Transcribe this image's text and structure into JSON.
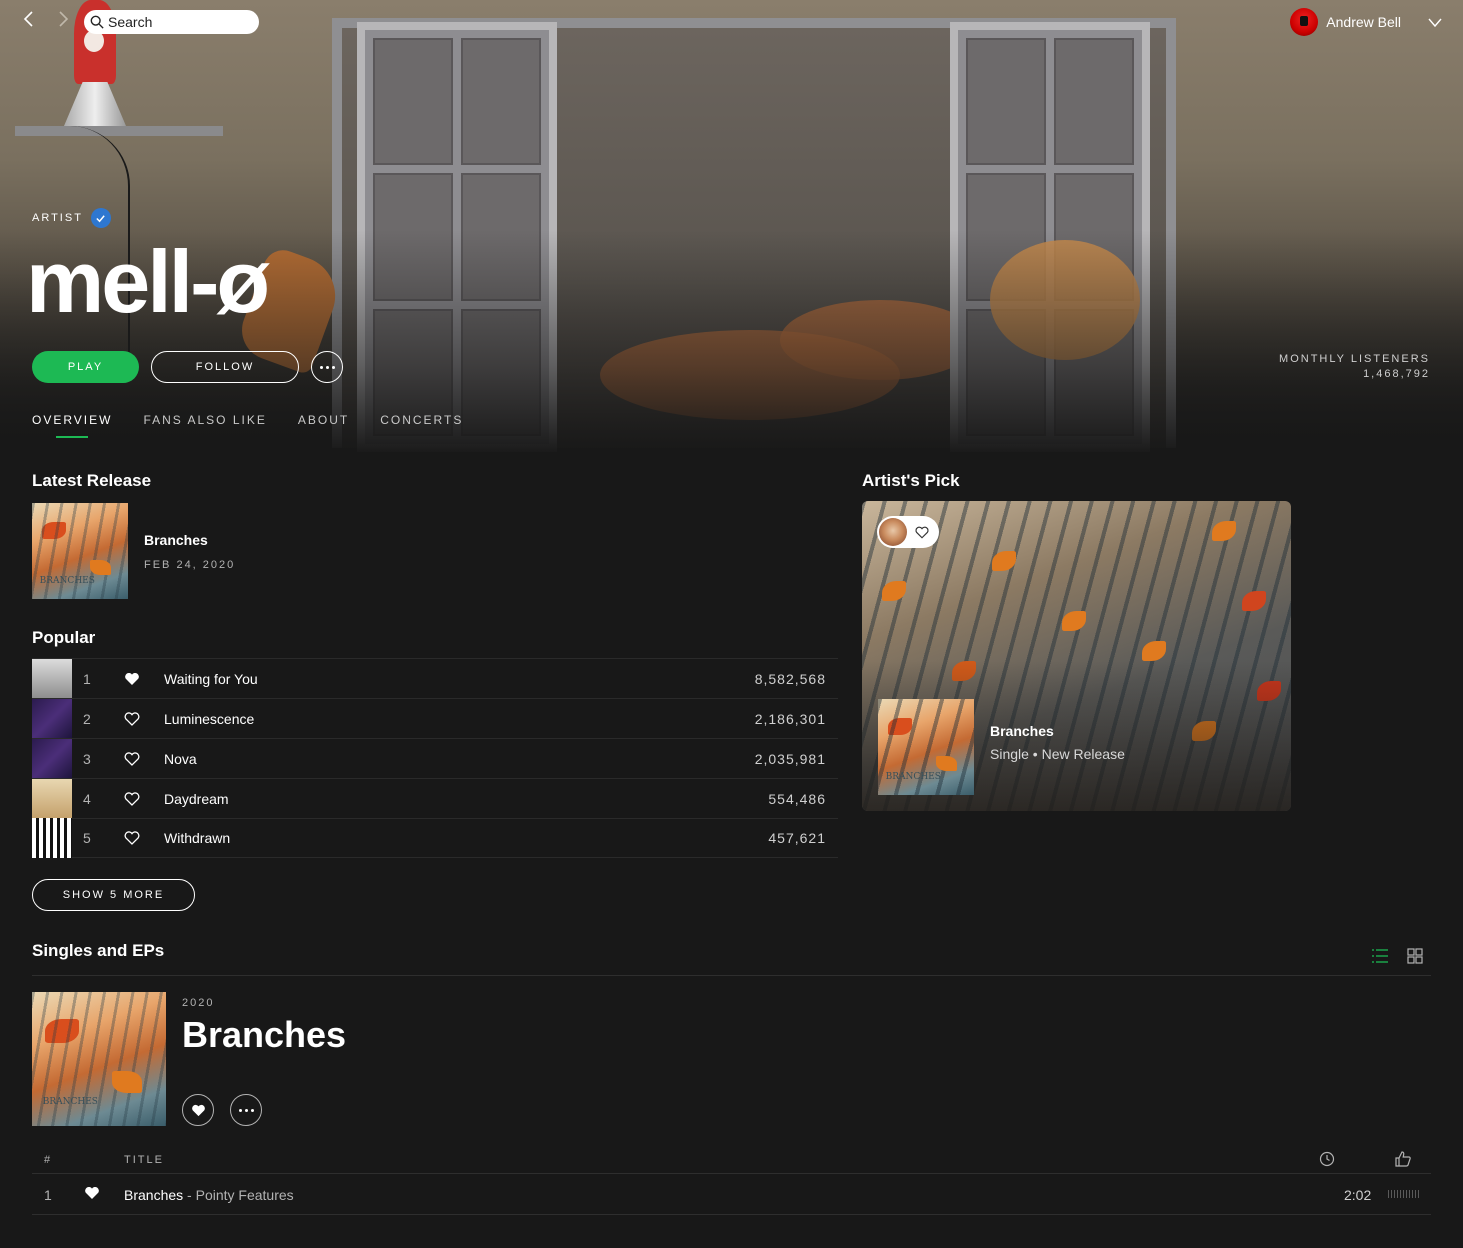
{
  "topbar": {
    "back_icon": "chevron-left-icon",
    "forward_icon": "chevron-right-icon",
    "search_placeholder": "Search",
    "user_name": "Andrew Bell"
  },
  "hero": {
    "label": "ARTIST",
    "artist_name": "mell-ø",
    "play_label": "PLAY",
    "follow_label": "FOLLOW",
    "monthly_label": "MONTHLY LISTENERS",
    "monthly_value": "1,468,792"
  },
  "tabs": [
    {
      "label": "OVERVIEW",
      "active": true
    },
    {
      "label": "FANS ALSO LIKE",
      "active": false
    },
    {
      "label": "ABOUT",
      "active": false
    },
    {
      "label": "CONCERTS",
      "active": false
    }
  ],
  "latest_release": {
    "heading": "Latest Release",
    "title": "Branches",
    "date": "FEB 24, 2020",
    "cover_text": "BRANCHES"
  },
  "popular": {
    "heading": "Popular",
    "tracks": [
      {
        "num": "1",
        "title": "Waiting for You",
        "plays": "8,582,568",
        "liked": true
      },
      {
        "num": "2",
        "title": "Luminescence",
        "plays": "2,186,301",
        "liked": false
      },
      {
        "num": "3",
        "title": "Nova",
        "plays": "2,035,981",
        "liked": false
      },
      {
        "num": "4",
        "title": "Daydream",
        "plays": "554,486",
        "liked": false
      },
      {
        "num": "5",
        "title": "Withdrawn",
        "plays": "457,621",
        "liked": false
      }
    ],
    "show_more_label": "SHOW 5 MORE"
  },
  "artists_pick": {
    "heading": "Artist's Pick",
    "title": "Branches",
    "subtitle": "Single • New Release",
    "cover_text": "BRANCHES"
  },
  "singles": {
    "heading": "Singles and EPs",
    "album_year": "2020",
    "album_title": "Branches",
    "cover_text": "BRANCHES",
    "header_num": "#",
    "header_title": "TITLE",
    "tracks": [
      {
        "num": "1",
        "title": "Branches",
        "separator": " - ",
        "featuring": "Pointy Features",
        "duration": "2:02",
        "liked": true
      }
    ]
  },
  "colors": {
    "accent": "#1db954",
    "background": "#181818",
    "verified": "#2e77d0"
  }
}
